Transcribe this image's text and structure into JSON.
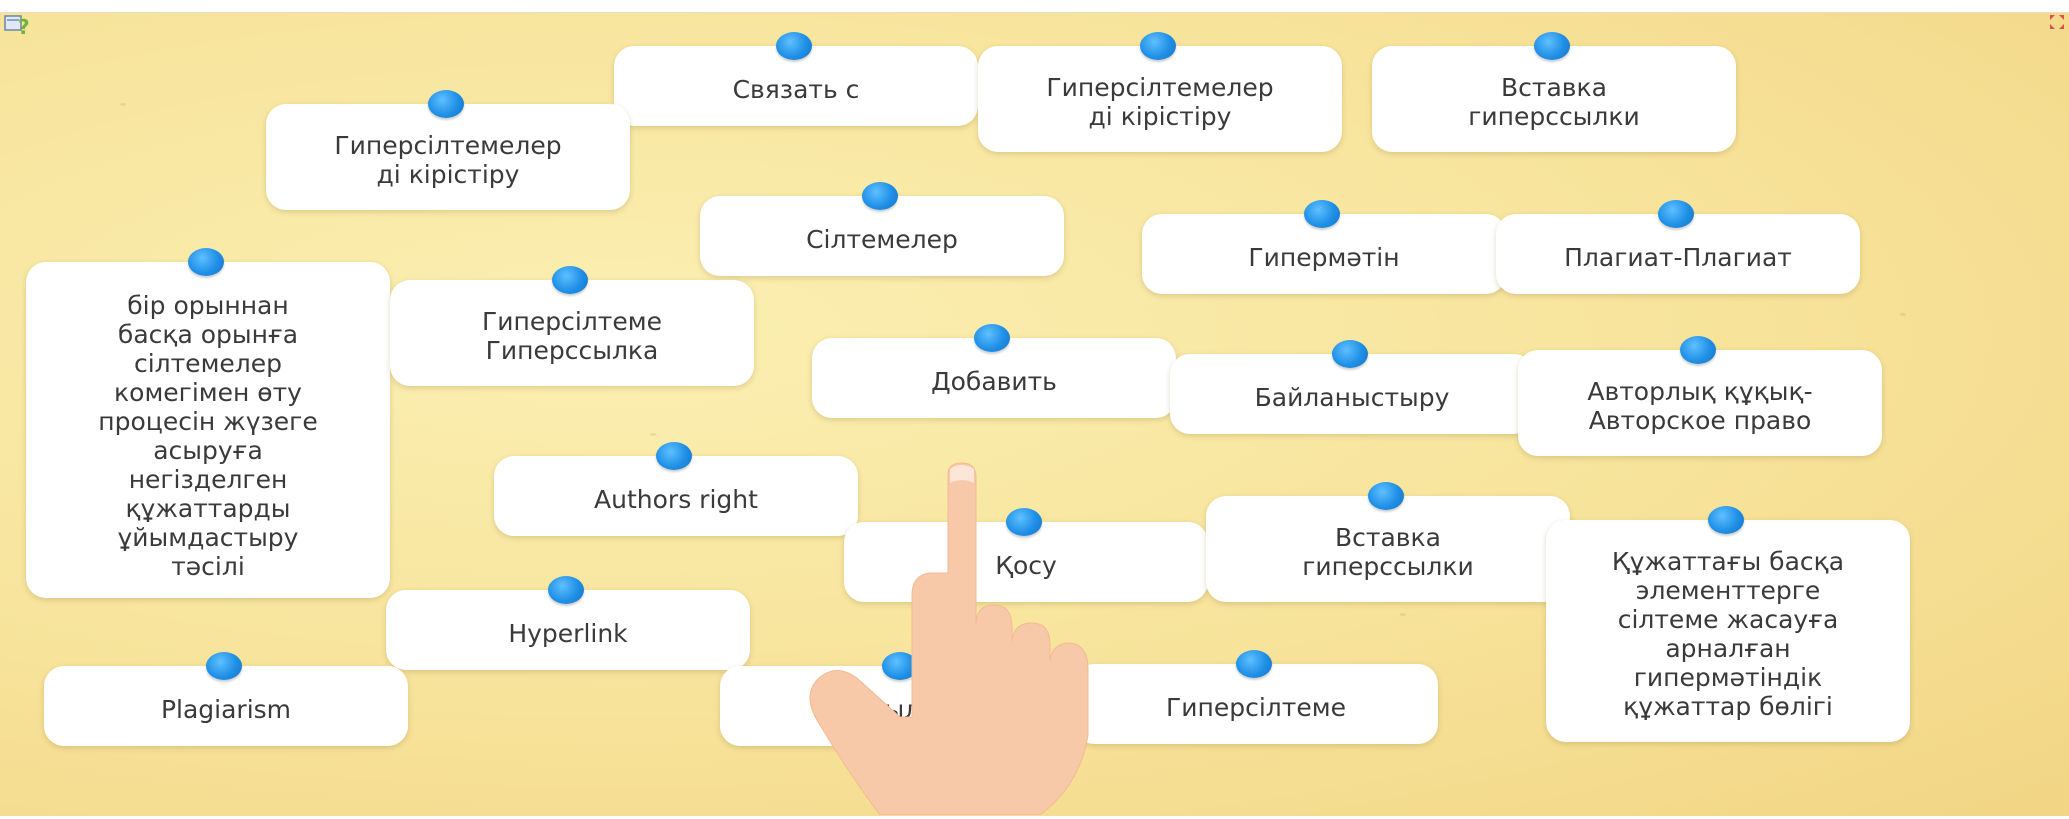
{
  "icons": {
    "help": "help-question-icon",
    "fullscreen": "fullscreen-icon",
    "hand": "pointing-hand-icon"
  },
  "colors": {
    "board": "#f7e39a",
    "card": "#ffffff",
    "pin": "#1f8fe6",
    "text": "#3a3a3a",
    "hand": "#f8c9a8"
  },
  "cards": [
    {
      "text": "Связать с"
    },
    {
      "text": "Гиперсілтемелер\nді кірістіру"
    },
    {
      "text": "Вставка\nгиперссылки"
    },
    {
      "text": "Гиперсілтемелер\nді кірістіру"
    },
    {
      "text": "Сілтемелер"
    },
    {
      "text": "Гипермәтін"
    },
    {
      "text": "Плагиат-Плагиат"
    },
    {
      "text": "бір орыннан\nбасқа орынға\nсілтемелер\nкомегімен өту\nпроцесін жүзеге\nасыруға\nнегізделген\nқұжаттарды\nұйымдастыру\nтәсілі"
    },
    {
      "text": "Гиперсілтеме\nГиперссылка"
    },
    {
      "text": "Добавить"
    },
    {
      "text": "Байланыстыру"
    },
    {
      "text": "Авторлық құқық-\nАвторское право"
    },
    {
      "text": "Authors right"
    },
    {
      "text": "Қосу"
    },
    {
      "text": "Вставка\nгиперссылки"
    },
    {
      "text": "Құжаттағы басқа\nэлементтерге\nсілтеме жасауға\nарналған\nгипермәтіндік\nқұжаттар бөлігі"
    },
    {
      "text": "Hyperlink"
    },
    {
      "text": "Plagiarism"
    },
    {
      "text": "Ссылка"
    },
    {
      "text": "Гиперсілтеме"
    }
  ]
}
